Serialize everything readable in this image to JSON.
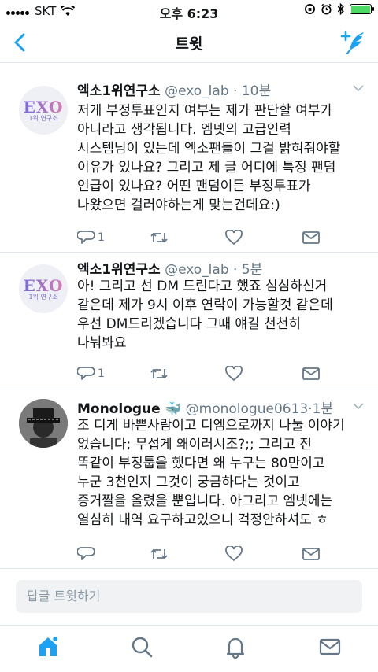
{
  "status_bar": {
    "carrier": "SKT",
    "time": "오후 6:23"
  },
  "nav": {
    "title": "트윗",
    "back_icon": "chevron-left-icon",
    "compose_icon": "compose-tweet-icon"
  },
  "tweets": [
    {
      "name": "엑소1위연구소",
      "handle": "@exo_lab",
      "time": "10분",
      "avatar_text": "EXO",
      "avatar_sub": "1위 연구소",
      "lines": [
        "저게 부정투표인지 여부는 제가 판단할 여부가",
        "아니라고 생각됩니다. 엠넷의 고급인력",
        "시스템님이 있는데 엑소팬들이 그걸 밝혀줘야할",
        "이유가 있나요? 그리고 제 글 어디에 특정 팬덤",
        "언급이 있나요? 어떤 팬덤이든 부정투표가",
        "나왔으면 걸러야하는게 맞는건데요:)"
      ],
      "reply_count": "1"
    },
    {
      "name": "엑소1위연구소",
      "handle": "@exo_lab",
      "time": "5분",
      "avatar_text": "EXO",
      "avatar_sub": "1위 연구소",
      "lines": [
        "아! 그리고 선 DM 드린다고 했죠 심심하신거",
        "같은데 제가 9시 이후 연락이 가능할것 같은데",
        "우선 DM드리겠습니다 그때 얘길 천천히",
        "나눠봐요"
      ],
      "reply_count": "1"
    },
    {
      "name": "Monologue",
      "name_emoji": "🐳",
      "handle": "@monologue0613",
      "time": "1분",
      "lines": [
        "조 디게 바쁜사람이고 디엠으로까지 나눌 이야기",
        "없습니다; 무섭게 왜이러시조?;; 그리고 전",
        "똑같이 부정툽을 했다면 왜 누구는 80만이고",
        "누군 3천인지 그것이 궁금하다는 것이고",
        "증거짤을 올렸을 뿐입니다. 아그리고 엠넷에는",
        "열심히 내역 요구하고있으니 걱정안하셔도 ㅎ"
      ]
    }
  ],
  "reply": {
    "placeholder": "답글 트윗하기"
  },
  "tabbar": {
    "items": [
      "home-icon",
      "search-icon",
      "notifications-icon",
      "messages-icon"
    ]
  },
  "colors": {
    "accent": "#1da1f2",
    "muted": "#657786",
    "divider": "#e1e8ed"
  }
}
